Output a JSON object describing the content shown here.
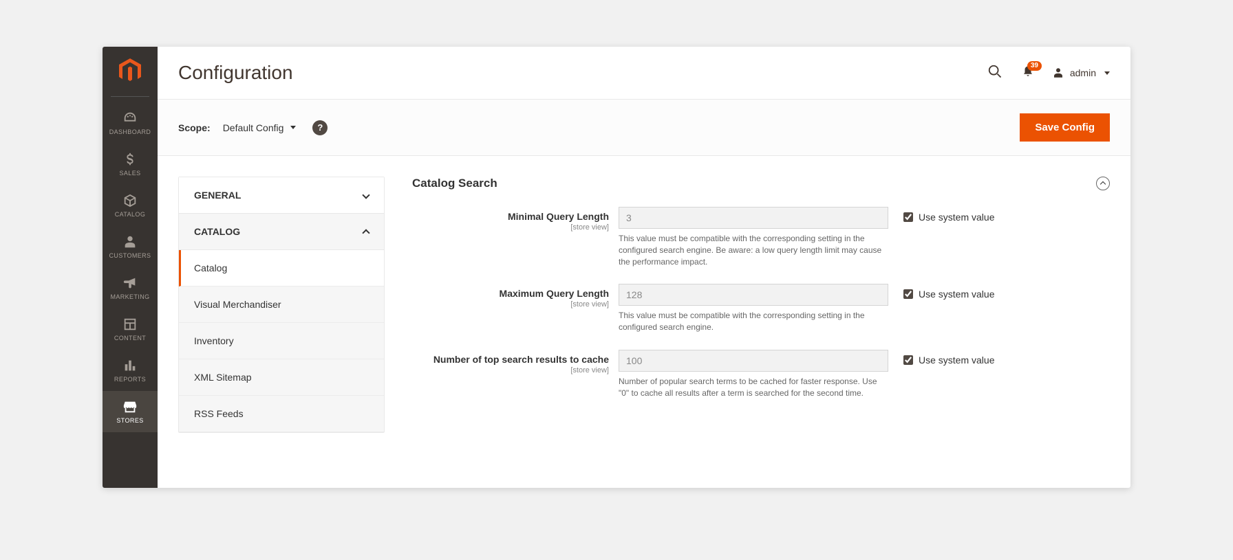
{
  "page_title": "Configuration",
  "notifications": {
    "count": "39"
  },
  "user": {
    "name": "admin"
  },
  "scope": {
    "label": "Scope:",
    "value": "Default Config"
  },
  "save_button": "Save Config",
  "sidebar": {
    "items": [
      {
        "label": "DASHBOARD"
      },
      {
        "label": "SALES"
      },
      {
        "label": "CATALOG"
      },
      {
        "label": "CUSTOMERS"
      },
      {
        "label": "MARKETING"
      },
      {
        "label": "CONTENT"
      },
      {
        "label": "REPORTS"
      },
      {
        "label": "STORES"
      }
    ]
  },
  "config_nav": {
    "sections": [
      {
        "label": "GENERAL",
        "expanded": false
      },
      {
        "label": "CATALOG",
        "expanded": true,
        "children": [
          {
            "label": "Catalog",
            "active": true
          },
          {
            "label": "Visual Merchandiser"
          },
          {
            "label": "Inventory"
          },
          {
            "label": "XML Sitemap"
          },
          {
            "label": "RSS Feeds"
          }
        ]
      }
    ]
  },
  "section": {
    "title": "Catalog Search",
    "fields": [
      {
        "label": "Minimal Query Length",
        "scope": "[store view]",
        "value": "3",
        "note": "This value must be compatible with the corresponding setting in the configured search engine. Be aware: a low query length limit may cause the performance impact.",
        "use_system": "Use system value"
      },
      {
        "label": "Maximum Query Length",
        "scope": "[store view]",
        "value": "128",
        "note": "This value must be compatible with the corresponding setting in the configured search engine.",
        "use_system": "Use system value"
      },
      {
        "label": "Number of top search results to cache",
        "scope": "[store view]",
        "value": "100",
        "note": "Number of popular search terms to be cached for faster response. Use \"0\" to cache all results after a term is searched for the second time.",
        "use_system": "Use system value"
      }
    ]
  }
}
